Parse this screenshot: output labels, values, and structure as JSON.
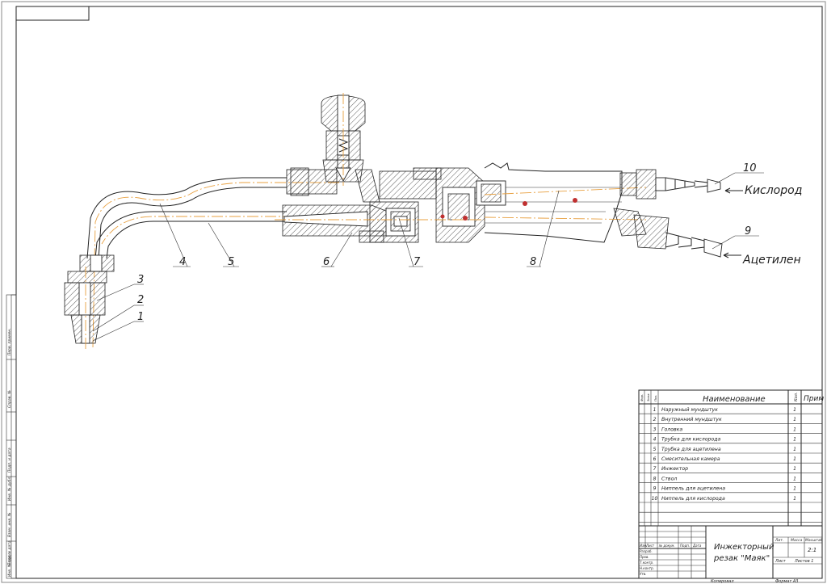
{
  "diagram": {
    "labels": {
      "n1": "1",
      "n2": "2",
      "n3": "3",
      "n4": "4",
      "n5": "5",
      "n6": "6",
      "n7": "7",
      "n8": "8",
      "n9": "9",
      "n10": "10",
      "oxygen": "Кислород",
      "acetylene": "Ацетилен"
    }
  },
  "spec_table": {
    "headers": {
      "format": "Фор.",
      "zone": "Зона",
      "pos": "Поз.",
      "name": "Наименование",
      "qty": "Кол.",
      "note": "Прим"
    },
    "rows": [
      {
        "pos": "1",
        "name": "Наружный мундштук",
        "qty": "1"
      },
      {
        "pos": "2",
        "name": "Внутренний мундштук",
        "qty": "1"
      },
      {
        "pos": "3",
        "name": "Головка",
        "qty": "1"
      },
      {
        "pos": "4",
        "name": "Трубка для кислорода",
        "qty": "1"
      },
      {
        "pos": "5",
        "name": "Трубка для ацетилена",
        "qty": "1"
      },
      {
        "pos": "6",
        "name": "Смесительная камера",
        "qty": "1"
      },
      {
        "pos": "7",
        "name": "Инжектор",
        "qty": "1"
      },
      {
        "pos": "8",
        "name": "Ствол",
        "qty": "1"
      },
      {
        "pos": "9",
        "name": "Ниппель для ацетилена",
        "qty": "1"
      },
      {
        "pos": "10",
        "name": "Ниппель для кислорода",
        "qty": "1"
      }
    ]
  },
  "title_block": {
    "title_line1": "Инжекторный",
    "title_line2": "резак \"Маяк\"",
    "lit": "Лит.",
    "mass": "Масса",
    "scale": "Масштаб",
    "scale_value": "2:1",
    "sheet": "Лист",
    "sheets": "Листов 1",
    "izm": "Изм.",
    "list": "Лист",
    "doc": "№ докум.",
    "sign": "Подп.",
    "date": "Дата",
    "razrab": "Разраб.",
    "prov": "Пров.",
    "tkontr": "Т.контр.",
    "nkontr": "Н.контр.",
    "utv": "Утв.",
    "copied": "Копировал",
    "format": "Формат А3"
  },
  "side_stamp": {
    "perv": "Перв. примен.",
    "sprav": "Справ. №",
    "podp_data1": "Подп. и дата",
    "inv_dubl": "Инв. № дубл.",
    "vzam": "Взам. инв. №",
    "podp_data2": "Подп. и дата",
    "inv_podl": "Инв. № подл."
  }
}
